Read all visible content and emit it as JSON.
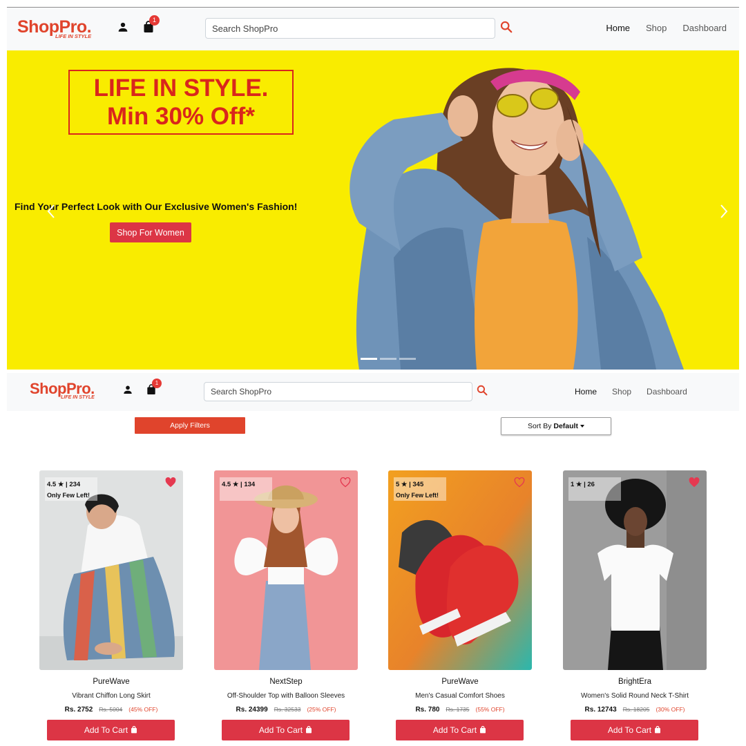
{
  "brand": {
    "name": "ShopPro.",
    "tagline": "LIFE IN STYLE"
  },
  "header": {
    "cart_count": "1",
    "search_placeholder": "Search ShopPro",
    "nav": [
      {
        "label": "Home",
        "active": true
      },
      {
        "label": "Shop",
        "active": false
      },
      {
        "label": "Dashboard",
        "active": false
      }
    ]
  },
  "hero": {
    "promo_line1": "LIFE IN STYLE.",
    "promo_line2": "Min 30% Off*",
    "caption": "Find Your Perfect Look with Our Exclusive Women's Fashion!",
    "cta_label": "Shop For Women",
    "slides_count": 3,
    "active_slide": 1
  },
  "filters": {
    "apply_label": "Apply Filters",
    "sort_prefix": "Sort By",
    "sort_value": "Default"
  },
  "products": [
    {
      "rating": "4.5",
      "reviews": "234",
      "stock_note": "Only Few Left!",
      "wishlisted": true,
      "brand": "PureWave",
      "name": "Vibrant Chiffon Long Skirt",
      "price": "Rs. 2752",
      "mrp": "Rs. 5004",
      "discount": "(45% OFF)",
      "cta_label": "Add To Cart"
    },
    {
      "rating": "4.5",
      "reviews": "134",
      "stock_note": "",
      "wishlisted": false,
      "brand": "NextStep",
      "name": "Off-Shoulder Top with Balloon Sleeves",
      "price": "Rs. 24399",
      "mrp": "Rs. 32533",
      "discount": "(25% OFF)",
      "cta_label": "Add To Cart"
    },
    {
      "rating": "5",
      "reviews": "345",
      "stock_note": "Only Few Left!",
      "wishlisted": false,
      "brand": "PureWave",
      "name": "Men's Casual Comfort Shoes",
      "price": "Rs. 780",
      "mrp": "Rs. 1735",
      "discount": "(55% OFF)",
      "cta_label": "Add To Cart"
    },
    {
      "rating": "1",
      "reviews": "26",
      "stock_note": "",
      "wishlisted": true,
      "brand": "BrightEra",
      "name": "Women's Solid Round Neck T-Shirt",
      "price": "Rs. 12743",
      "mrp": "Rs. 18205",
      "discount": "(30% OFF)",
      "cta_label": "Add To Cart"
    }
  ],
  "colors": {
    "brand": "#e0442c",
    "cta": "#dc3545",
    "hero_bg": "#f9ec00",
    "heart": "#e53950"
  },
  "icons": {
    "user": "user-icon",
    "cart": "shopping-bag-icon",
    "search": "search-icon",
    "heart": "heart-icon",
    "prev": "chevron-left-icon",
    "next": "chevron-right-icon"
  }
}
